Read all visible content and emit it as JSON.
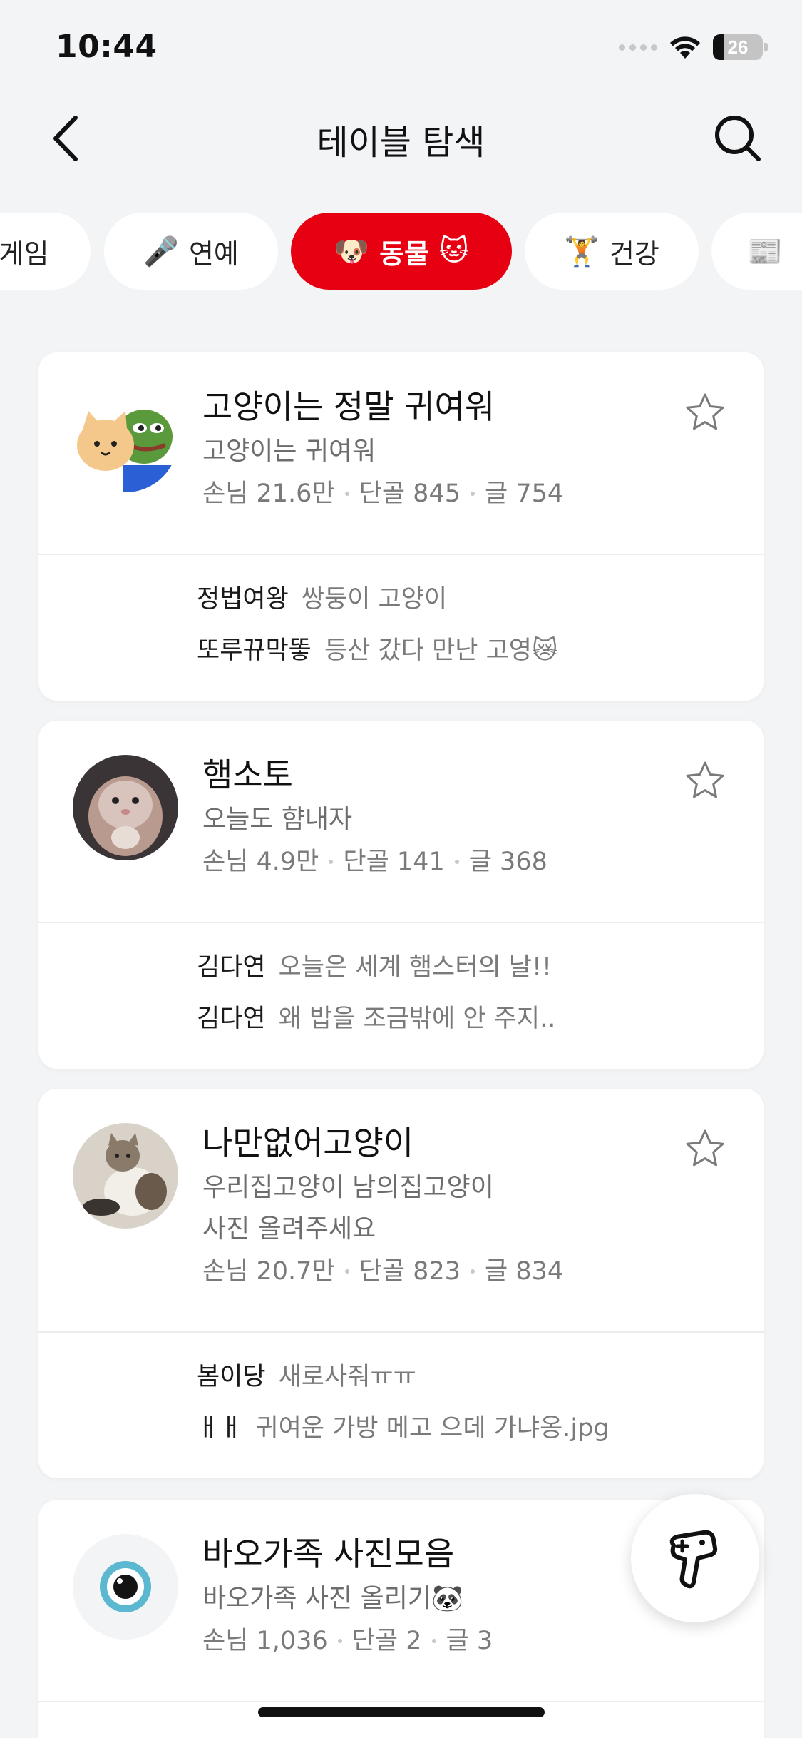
{
  "status_bar": {
    "time": "10:44",
    "battery": "26"
  },
  "nav": {
    "title": "테이블 탐색"
  },
  "categories": [
    {
      "emoji": "",
      "label": "게임",
      "emoji_after": ""
    },
    {
      "emoji": "🎤",
      "label": "연예",
      "emoji_after": ""
    },
    {
      "emoji": "🐶",
      "label": "동물",
      "emoji_after": "🐱"
    },
    {
      "emoji": "🏋️",
      "label": "건강",
      "emoji_after": ""
    },
    {
      "emoji": "📰",
      "label": "",
      "emoji_after": ""
    }
  ],
  "tables": [
    {
      "title": "고양이는 정말 귀여워",
      "desc": "고양이는 귀여워",
      "guests": "손님 21.6만",
      "regulars": "단골 845",
      "posts_count": "글 754",
      "posts": [
        {
          "author": "정법여왕",
          "text": "쌍둥이 고양이"
        },
        {
          "author": "또루뀨막똫",
          "text": "등산 갔다 만난 고영😿"
        }
      ]
    },
    {
      "title": "햄소토",
      "desc": "오늘도 햠내자",
      "guests": "손님 4.9만",
      "regulars": "단골 141",
      "posts_count": "글 368",
      "posts": [
        {
          "author": "김다연",
          "text": "오늘은 세계 햄스터의 날!!"
        },
        {
          "author": "김다연",
          "text": "왜 밥을 조금밖에 안 주지.."
        }
      ]
    },
    {
      "title": "나만없어고양이",
      "desc": "우리집고양이 남의집고양이",
      "desc2": "사진 올려주세요",
      "guests": "손님 20.7만",
      "regulars": "단골 823",
      "posts_count": "글 834",
      "posts": [
        {
          "author": "봄이당",
          "text": "새로사줘ㅠㅠ"
        },
        {
          "author": "ㅐㅐ",
          "text": "귀여운 가방 메고 으데 가냐옹.jpg"
        }
      ]
    },
    {
      "title": "바오가족 사진모음",
      "desc": "바오가족 사진 올리기🐼",
      "guests": "손님 1,036",
      "regulars": "단골 2",
      "posts_count": "글 3"
    }
  ],
  "colors": {
    "accent": "#e60012",
    "background": "#f3f4f6"
  },
  "icons": {
    "back": "chevron-left-icon",
    "search": "search-icon",
    "star": "star-outline-icon",
    "fab": "gamepad-plus-icon"
  }
}
